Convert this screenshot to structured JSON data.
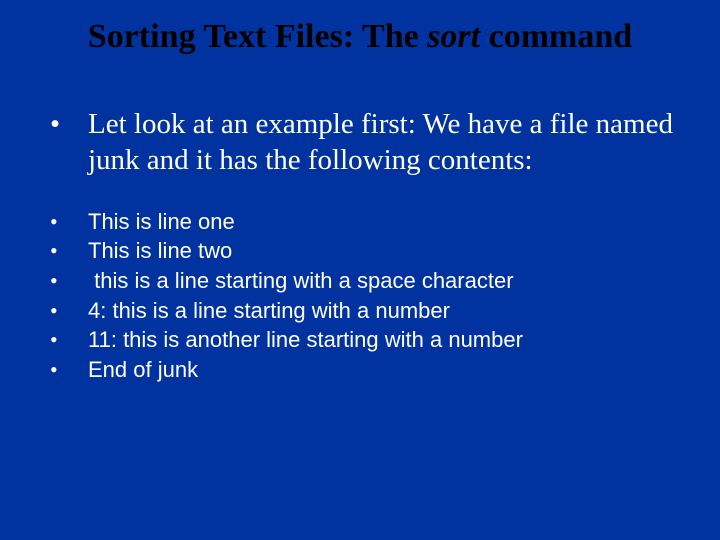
{
  "title": {
    "part1": "Sorting Text Files: The ",
    "italic": "sort",
    "part2": " command"
  },
  "main_bullet": "Let look at an example first: We have a file named junk and it has the following contents:",
  "lines": [
    "This is line one",
    "This is line two",
    " this is a line starting with a space character",
    "4: this is a line starting with a number",
    "11: this is another line starting with a number",
    "End of junk"
  ]
}
